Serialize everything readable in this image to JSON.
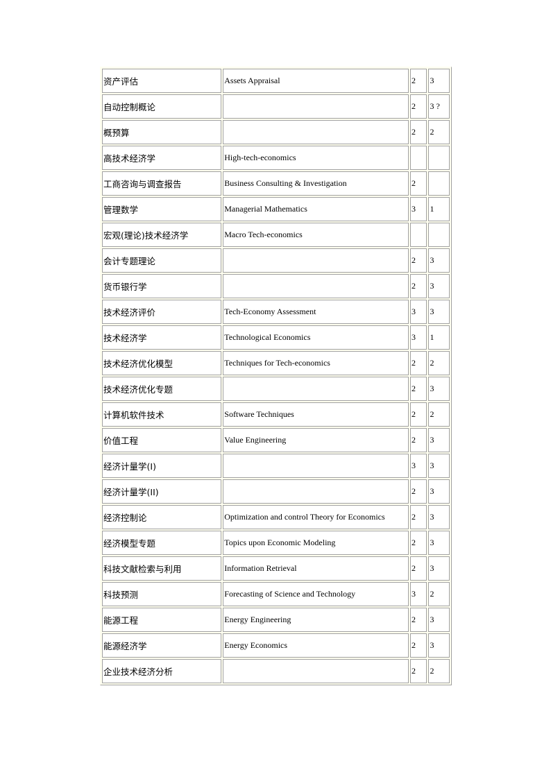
{
  "table": {
    "rows": [
      {
        "cn": "资产评估",
        "en": "Assets Appraisal",
        "a": "2",
        "b": "3"
      },
      {
        "cn": "自动控制概论",
        "en": "",
        "a": "2",
        "b": "3 ?"
      },
      {
        "cn": "概预算",
        "en": "",
        "a": "2",
        "b": "2"
      },
      {
        "cn": "高技术经济学",
        "en": "High-tech-economics",
        "a": "",
        "b": ""
      },
      {
        "cn": "工商咨询与调查报告",
        "en": "Business Consulting & Investigation",
        "a": "2",
        "b": ""
      },
      {
        "cn": "管理数学",
        "en": "Managerial Mathematics",
        "a": "3",
        "b": "1"
      },
      {
        "cn": "宏观(理论)技术经济学",
        "en": "Macro Tech-economics",
        "a": "",
        "b": ""
      },
      {
        "cn": "会计专题理论",
        "en": "",
        "a": "2",
        "b": "3"
      },
      {
        "cn": "货币银行学",
        "en": "",
        "a": "2",
        "b": "3"
      },
      {
        "cn": "技术经济评价",
        "en": "Tech-Economy Assessment",
        "a": "3",
        "b": "3"
      },
      {
        "cn": "技术经济学",
        "en": "Technological  Economics",
        "a": "3",
        "b": "1"
      },
      {
        "cn": "技术经济优化模型",
        "en": "Techniques for Tech-economics",
        "a": "2",
        "b": "2"
      },
      {
        "cn": "技术经济优化专题",
        "en": "",
        "a": "2",
        "b": "3"
      },
      {
        "cn": "计算机软件技术",
        "en": "Software Techniques",
        "a": "2",
        "b": "2"
      },
      {
        "cn": "价值工程",
        "en": "Value Engineering",
        "a": "2",
        "b": "3"
      },
      {
        "cn": "经济计量学(Ⅰ)",
        "en": "",
        "a": "3",
        "b": "3"
      },
      {
        "cn": "经济计量学(II)",
        "en": "",
        "a": "2",
        "b": "3"
      },
      {
        "cn": "经济控制论",
        "en": "Optimization and control Theory for Economics",
        "a": "2",
        "b": "3"
      },
      {
        "cn": "经济模型专题",
        "en": "Topics upon Economic Modeling",
        "a": "2",
        "b": "3"
      },
      {
        "cn": "科技文献检索与利用",
        "en": "Information Retrieval",
        "a": "2",
        "b": "3"
      },
      {
        "cn": "科技预测",
        "en": "Forecasting of Science and Technology",
        "a": "3",
        "b": "2"
      },
      {
        "cn": "能源工程",
        "en": "Energy Engineering",
        "a": "2",
        "b": "3"
      },
      {
        "cn": "能源经济学",
        "en": "Energy Economics",
        "a": "2",
        "b": "3"
      },
      {
        "cn": "企业技术经济分析",
        "en": "",
        "a": "2",
        "b": "2"
      }
    ]
  }
}
